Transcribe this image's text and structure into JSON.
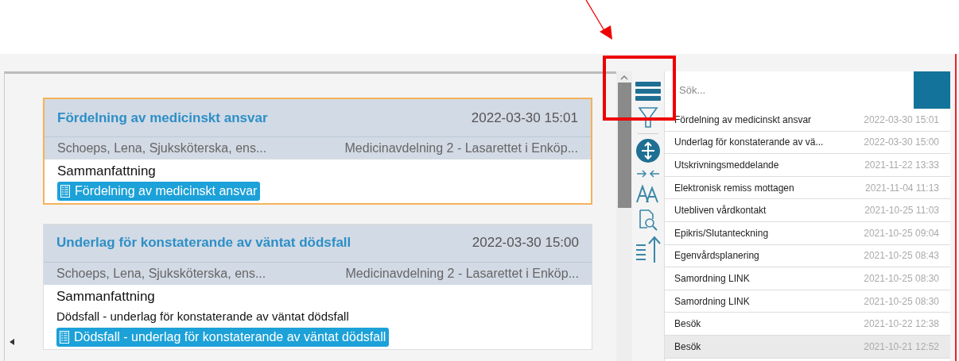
{
  "cards": [
    {
      "title": "Fördelning av medicinskt ansvar",
      "datetime": "2022-03-30 15:01",
      "author": "Schoeps, Lena, Sjuksköterska, ens...",
      "unit": "Medicinavdelning 2 - Lasarettet i Enköp...",
      "heading": "Sammanfattning",
      "tag": "Fördelning av medicinskt ansvar",
      "selected": true
    },
    {
      "title": "Underlag för konstaterande av väntat dödsfall",
      "datetime": "2022-03-30 15:00",
      "author": "Schoeps, Lena, Sjuksköterska, ens...",
      "unit": "Medicinavdelning 2 - Lasarettet i Enköp...",
      "heading": "Sammanfattning",
      "text": "Dödsfall - underlag för konstaterande av väntat dödsfall",
      "tag": "Dödsfall - underlag för konstaterande av väntat dödsfall",
      "selected": false
    }
  ],
  "toolbar": [
    {
      "kind": "menu"
    },
    {
      "kind": "filter"
    },
    {
      "kind": "expand"
    },
    {
      "kind": "collapse"
    },
    {
      "kind": "font"
    },
    {
      "kind": "preview"
    },
    {
      "kind": "sort"
    }
  ],
  "search": {
    "placeholder": "Sök..."
  },
  "list": [
    {
      "title": "Fördelning av medicinskt ansvar",
      "datetime": "2022-03-30 15:01",
      "selected": false
    },
    {
      "title": "Underlag för konstaterande av vä...",
      "datetime": "2022-03-30 15:00",
      "selected": false
    },
    {
      "title": "Utskrivningsmeddelande",
      "datetime": "2021-11-22 13:33",
      "selected": false
    },
    {
      "title": "Elektronisk remiss mottagen",
      "datetime": "2021-11-04 11:13",
      "selected": false
    },
    {
      "title": "Utebliven vårdkontakt",
      "datetime": "2021-10-25 11:03",
      "selected": false
    },
    {
      "title": "Epikris/Slutanteckning",
      "datetime": "2021-10-25 09:04",
      "selected": false
    },
    {
      "title": "Egenvårdsplanering",
      "datetime": "2021-10-25 08:43",
      "selected": false
    },
    {
      "title": "Samordning LINK",
      "datetime": "2021-10-25 08:30",
      "selected": false
    },
    {
      "title": "Samordning LINK",
      "datetime": "2021-10-25 08:30",
      "selected": false
    },
    {
      "title": "Besök",
      "datetime": "2021-10-22 12:38",
      "selected": false
    },
    {
      "title": "Besök",
      "datetime": "2021-10-21 12:52",
      "selected": true
    }
  ]
}
